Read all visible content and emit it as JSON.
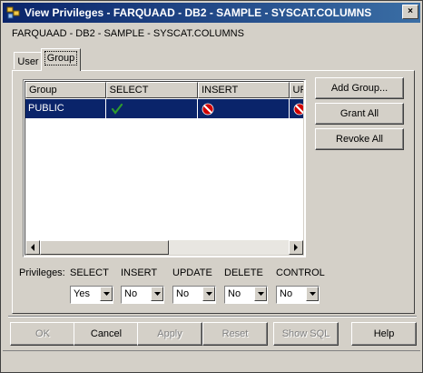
{
  "window": {
    "title": "View Privileges - FARQUAAD - DB2 - SAMPLE - SYSCAT.COLUMNS",
    "close_label": "×"
  },
  "subtitle": "FARQUAAD - DB2 - SAMPLE - SYSCAT.COLUMNS",
  "tabs": [
    {
      "label": "User"
    },
    {
      "label": "Group"
    }
  ],
  "table": {
    "headers": [
      "Group",
      "SELECT",
      "INSERT",
      "UP"
    ],
    "rows": [
      {
        "group": "PUBLIC",
        "select": "check-icon",
        "insert": "deny-icon",
        "update": "deny-icon"
      }
    ]
  },
  "side_buttons": {
    "add_group": "Add Group...",
    "grant_all": "Grant All",
    "revoke_all": "Revoke All"
  },
  "privileges": {
    "label": "Privileges:",
    "items": [
      {
        "label": "SELECT",
        "value": "Yes"
      },
      {
        "label": "INSERT",
        "value": "No"
      },
      {
        "label": "UPDATE",
        "value": "No"
      },
      {
        "label": "DELETE",
        "value": "No"
      },
      {
        "label": "CONTROL",
        "value": "No"
      }
    ]
  },
  "bottom_buttons": {
    "ok": "OK",
    "cancel": "Cancel",
    "apply": "Apply",
    "reset": "Reset",
    "show_sql": "Show SQL",
    "help": "Help"
  },
  "colors": {
    "selection": "#0a246a",
    "check": "#2e9a2e",
    "deny": "#d00000"
  }
}
